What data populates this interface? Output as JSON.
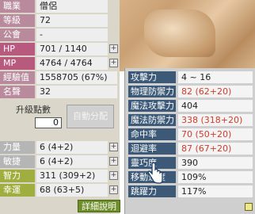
{
  "stats": {
    "job": {
      "label": "職業",
      "value": "僧侶"
    },
    "level": {
      "label": "等級",
      "value": "72"
    },
    "guild": {
      "label": "公會",
      "value": "-"
    },
    "hp": {
      "label": "HP",
      "value": "701 / 1140"
    },
    "mp": {
      "label": "MP",
      "value": "4764 / 4764"
    },
    "exp": {
      "label": "經驗值",
      "value": "1558705 (67%)"
    },
    "fame": {
      "label": "名聲",
      "value": "32"
    }
  },
  "ability_points": {
    "label": "升級點數",
    "value": "0",
    "auto_button": "自動分配"
  },
  "attributes": [
    {
      "label": "力量",
      "value": "6 (4+2)"
    },
    {
      "label": "敏捷",
      "value": "6 (4+2)"
    },
    {
      "label": "智力",
      "value": "311 (309+2)"
    },
    {
      "label": "幸運",
      "value": "68 (63+5)"
    }
  ],
  "detail_button": "詳細說明",
  "detail": [
    {
      "label": "攻擊力",
      "value": "4 ~ 16",
      "bonus": false
    },
    {
      "label": "物理防禦力",
      "value": "82 (62+20)",
      "bonus": true
    },
    {
      "label": "魔法攻擊力",
      "value": "404",
      "bonus": false
    },
    {
      "label": "魔法防禦力",
      "value": "338 (318+20)",
      "bonus": true
    },
    {
      "label": "命中率",
      "value": "70 (50+20)",
      "bonus": true
    },
    {
      "label": "迴避率",
      "value": "87 (67+20)",
      "bonus": true
    },
    {
      "label": "靈巧度",
      "value": "390",
      "bonus": false
    },
    {
      "label": "移動速度",
      "value": "109%",
      "bonus": false
    },
    {
      "label": "跳躍力",
      "value": "117%",
      "bonus": false
    }
  ],
  "icons": {
    "plus": "plus-icon",
    "cursor": "hand-cursor-icon"
  }
}
